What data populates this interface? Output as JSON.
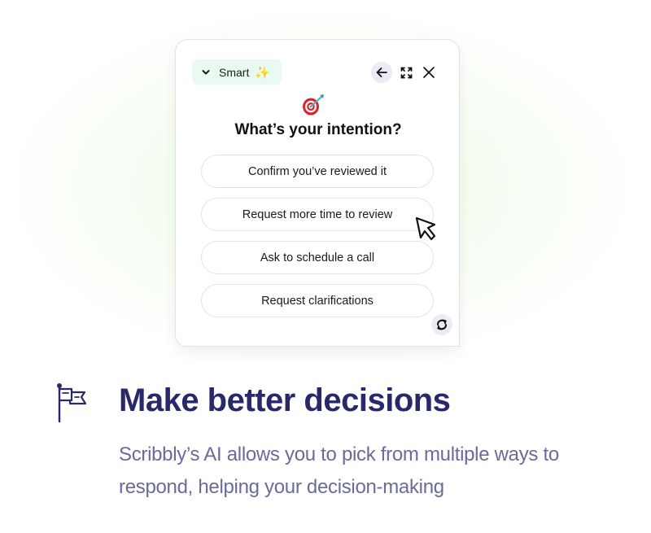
{
  "widget": {
    "mode_selector": {
      "label": "Smart",
      "icon": "chevron-down-icon",
      "sparkle": "✨"
    },
    "header_actions": [
      {
        "name": "back",
        "icon": "arrow-left-icon"
      },
      {
        "name": "expand",
        "icon": "expand-icon"
      },
      {
        "name": "close",
        "icon": "close-icon"
      }
    ],
    "emoji": "🎯",
    "title": "What’s your intention?",
    "options": [
      {
        "label": "Confirm you’ve reviewed it"
      },
      {
        "label": "Request more time to review"
      },
      {
        "label": "Ask to schedule a call"
      },
      {
        "label": "Request clarifications"
      }
    ],
    "refresh_icon": "refresh-icon"
  },
  "feature": {
    "icon": "flag-icon",
    "headline": "Make better decisions",
    "description": "Scribbly’s AI allows you to pick from multiple ways to respond, helping your decision-making"
  },
  "colors": {
    "headline": "#28286b",
    "description": "#6a6a9c",
    "mode_pill_bg": "#e9fbf1",
    "icon_button_bg": "#ebebf3",
    "glow": "#e6fadc"
  }
}
